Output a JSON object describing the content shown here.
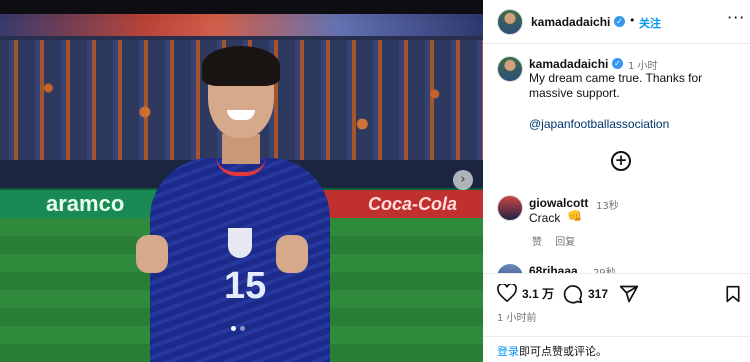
{
  "post": {
    "username": "kamadadaichi",
    "follow_label": "关注",
    "dot": "•",
    "more": "···",
    "caption_time": "1 小时",
    "caption": "My dream came true. Thanks for massive support.",
    "mention": "@japanfootballassociation",
    "load_more_symbol": "+"
  },
  "photo": {
    "board_left": "aramco",
    "board_right": "Coca-Cola",
    "jersey_number": "15",
    "next_symbol": "›",
    "slides_total": 2,
    "slide_active": 1
  },
  "comments": [
    {
      "username": "giowalcott",
      "time": "13秒",
      "text": "Crack",
      "emoji": "👊",
      "like_label": "赞",
      "reply_label": "回复"
    },
    {
      "username": "68rihaaa",
      "time": "29秒"
    }
  ],
  "actions": {
    "likes": "3.1 万",
    "comments": "317",
    "post_time": "1 小时前"
  },
  "footer": {
    "login_link": "登录",
    "login_text": "即可点赞或评论。"
  },
  "colors": {
    "accent": "#0095f6",
    "verified": "#3797f0",
    "secondary_text": "#737373"
  }
}
